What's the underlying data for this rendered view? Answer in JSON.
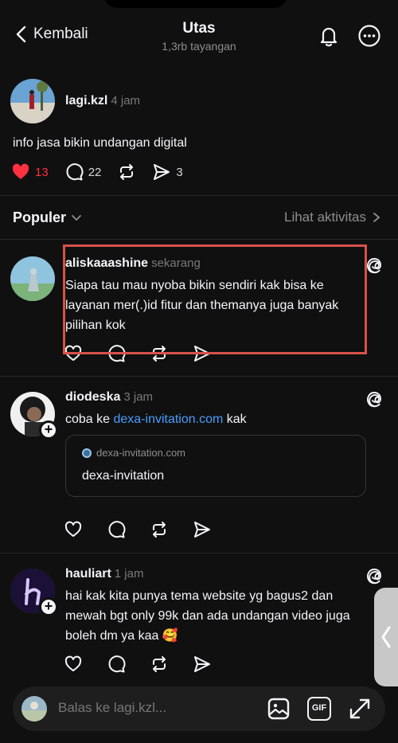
{
  "header": {
    "back_label": "Kembali",
    "title": "Utas",
    "subtitle": "1,3rb tayangan"
  },
  "root_post": {
    "username": "lagi.kzl",
    "time": "4 jam",
    "text": "info jasa bikin undangan digital",
    "likes": "13",
    "replies": "22",
    "shares": "3"
  },
  "sort": {
    "label": "Populer",
    "activity_label": "Lihat aktivitas"
  },
  "replies": [
    {
      "username": "aliskaaashine",
      "time": "sekarang",
      "text": "Siapa tau mau nyoba bikin sendiri kak bisa ke layanan mer(.)id fitur dan themanya juga banyak pilihan kok"
    },
    {
      "username": "diodeska",
      "time": "3 jam",
      "text_prefix": "coba ke ",
      "link_text": "dexa-invitation.com",
      "text_suffix": " kak",
      "card_domain": "dexa-invitation.com",
      "card_title": "dexa-invitation"
    },
    {
      "username": "hauliart",
      "time": "1 jam",
      "text": "hai kak kita punya tema website yg bagus2 dan mewah bgt only 99k dan ada undangan video juga boleh dm ya kaa 🥰"
    }
  ],
  "compose": {
    "placeholder": "Balas ke lagi.kzl...",
    "gif_label": "GIF"
  },
  "colors": {
    "background": "#101010",
    "like_red": "#ff3040",
    "link_blue": "#4a9dff",
    "highlight_red": "#d9514a"
  }
}
